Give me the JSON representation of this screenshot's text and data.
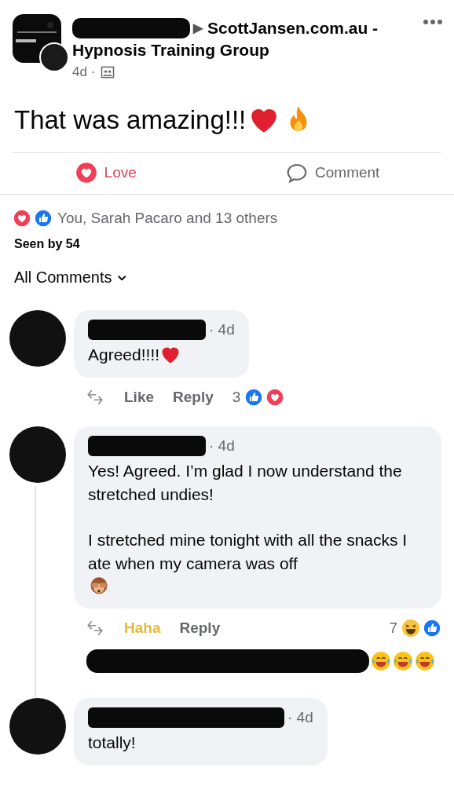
{
  "post": {
    "header": {
      "arrow": "▶",
      "group_lines": [
        "ScottJansen.com.au -",
        "Hypnosis Training Group"
      ],
      "meta": "4d ·",
      "audience": {
        "kind": "group"
      }
    },
    "text": "That was amazing!!!",
    "text_icons": [
      {
        "kind": "heart"
      },
      {
        "kind": "fire"
      }
    ],
    "actions": [
      {
        "label": "Love",
        "kind": "love",
        "selected": true
      },
      {
        "label": "Comment",
        "kind": "comment",
        "selected": false
      }
    ],
    "reactions": {
      "icons": [
        {
          "kind": "love"
        },
        {
          "kind": "like"
        }
      ],
      "summary": "You, Sarah Pacaro and 13 others"
    },
    "seen_by": "Seen by 54"
  },
  "comments_filter": "All Comments",
  "comments": [
    {
      "meta": "· 4d",
      "paragraphs": [
        "Agreed!!!!"
      ],
      "text_icons": [
        {
          "kind": "heart"
        }
      ],
      "actions": [
        {
          "label": "Like",
          "reacted": false
        },
        {
          "label": "Reply",
          "reacted": false
        }
      ],
      "count": "3",
      "count_icons": [
        {
          "kind": "like"
        },
        {
          "kind": "love"
        }
      ],
      "thread": false
    },
    {
      "meta": "· 4d",
      "paragraphs": [
        "Yes! Agreed. I’m glad I now understand the stretched undies!",
        "I stretched mine tonight with all the snacks I ate when my camera was off"
      ],
      "text_icons": [
        {
          "kind": "monkey"
        }
      ],
      "actions": [
        {
          "label": "Haha",
          "reacted": true
        },
        {
          "label": "Reply",
          "reacted": false
        }
      ],
      "count": "7",
      "count_icons": [
        {
          "kind": "haha"
        },
        {
          "kind": "like"
        }
      ],
      "thread": true,
      "reply_preview_icons": [
        {
          "kind": "laugh-cry"
        },
        {
          "kind": "laugh-cry"
        },
        {
          "kind": "laugh-cry"
        }
      ]
    },
    {
      "meta": "· 4d",
      "paragraphs": [
        "totally!"
      ],
      "thread": false
    }
  ]
}
